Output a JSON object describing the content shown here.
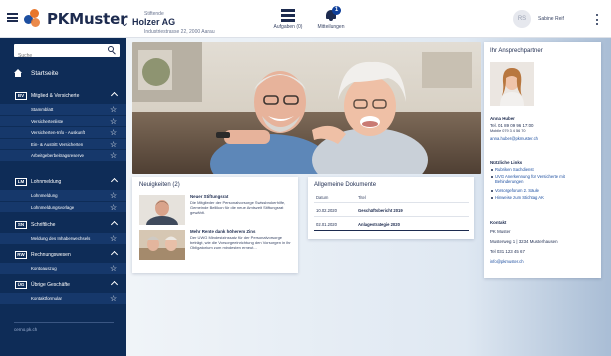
{
  "header": {
    "logo": "PKMuster",
    "client_label": "Stiftende",
    "client_name": "Holzer AG",
    "client_address": "Industriestrasse 22, 2000 Aarau",
    "tasks_label": "Aufgaben (0)",
    "notifications_label": "Mitteilungen",
    "notifications_count": "1",
    "user_initials": "RS",
    "user_name": "Sabine Reif"
  },
  "sidebar": {
    "search_placeholder": "Suche",
    "home_label": "Startseite",
    "sections": [
      {
        "abbr": "BV",
        "title": "Mitglied & Versicherte",
        "items": [
          "Stammblatt",
          "Versichertenliste",
          "Versicherten-Info - Auskunft",
          "Ein- & Austritt Versicherten",
          "Arbeitgeberbeitragsreserve"
        ]
      },
      {
        "abbr": "LM",
        "title": "Lohnmeldung",
        "items": [
          "Lohnmeldung",
          "Lohnmeldungsvorlage"
        ]
      },
      {
        "abbr": "SN",
        "title": "Schriftliche",
        "items": [
          "Meldung des Inhaberwechsels"
        ]
      },
      {
        "abbr": "RW",
        "title": "Rechnungswesen",
        "items": [
          "Kontoauszug"
        ]
      },
      {
        "abbr": "ÜG",
        "title": "Übrige Geschäfte",
        "items": [
          "Kontaktformular"
        ]
      }
    ],
    "footer": "cerno.pk.ch"
  },
  "news": {
    "title": "Neuigkeiten (2)",
    "items": [
      {
        "title": "Neuer Stiftungsrat",
        "text": "Die Mitglieder der Personalvorsorge Swissbrokerhilfe, Gemeinde Bellikon für die neue Amtszeit Stiftungsrat gewählt."
      },
      {
        "title": "Mehr Rente dank höherem Zins",
        "text": "Der UWG Mindestzinssatz für der Personalvorsorge beträgt, wie die Vorsorgeeinrichtung den Vorsorgen in ihr Obligatorium zum mindesten erneut..."
      }
    ]
  },
  "documents": {
    "title": "Allgemeine Dokumente",
    "col_date": "Datum",
    "col_title": "Titel",
    "rows": [
      {
        "date": "10.02.2020",
        "title": "Geschäftsbericht 2019"
      },
      {
        "date": "02.01.2020",
        "title": "Anlagestrategie 2020"
      }
    ]
  },
  "contact": {
    "title": "Ihr Ansprechpartner",
    "name": "Anna Huber",
    "phone": "Tel. 01 89 09 96 17:00",
    "phone2": "Mobile 079 3 4 56 70",
    "email": "anna.huber@pkmuster.ch",
    "links_title": "Nützliche Links",
    "links": [
      "Rubriken Sachdienst",
      "UVG Anerkennung für Versicherte mit Behinderungen",
      "Vorsorgeforum 2. Säule",
      "Hinweise zum Stichtag AK"
    ],
    "contact_title": "Kontakt",
    "org": "PK Muster",
    "street": "Musterweg 1 | 3234 Musterhausen",
    "tel": "Tel 031 123 45 67",
    "mail": "info@pkmuster.ch"
  }
}
